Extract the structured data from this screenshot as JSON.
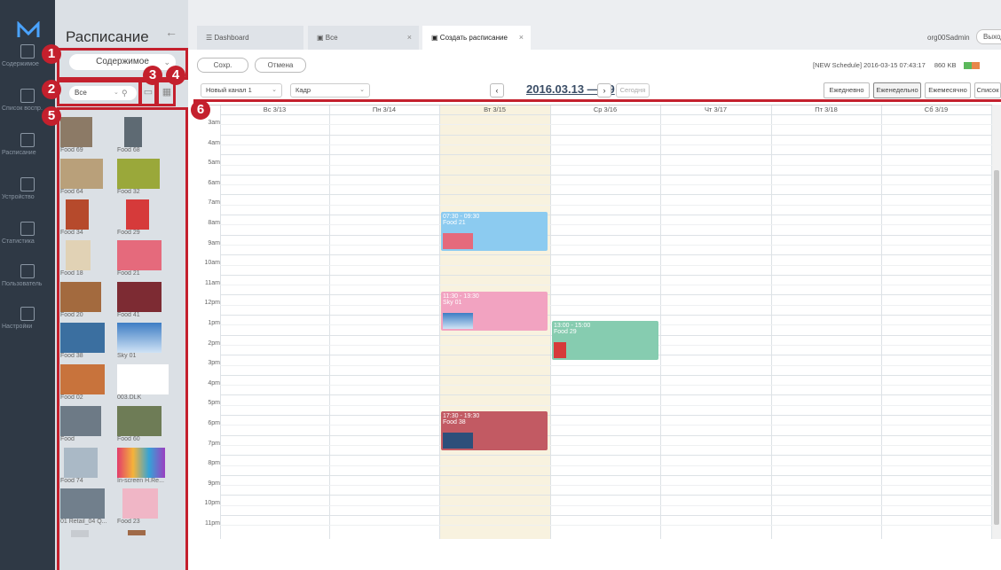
{
  "sidebar_nav": {
    "items": [
      {
        "label": "Содержимое"
      },
      {
        "label": "Список воспр."
      },
      {
        "label": "Расписание"
      },
      {
        "label": "Устройство"
      },
      {
        "label": "Статистика"
      },
      {
        "label": "Пользователь"
      },
      {
        "label": "Настройки"
      }
    ]
  },
  "panel": {
    "title": "Расписание",
    "content_dropdown": "Содержимое",
    "filter_value": "Все",
    "thumbnails": [
      {
        "caption": "Food 69"
      },
      {
        "caption": "Food 68"
      },
      {
        "caption": "Food 64"
      },
      {
        "caption": "Food 32"
      },
      {
        "caption": "Food 34"
      },
      {
        "caption": "Food 29"
      },
      {
        "caption": "Food 18"
      },
      {
        "caption": "Food 21"
      },
      {
        "caption": "Food 20"
      },
      {
        "caption": "Food 41"
      },
      {
        "caption": "Food 38"
      },
      {
        "caption": "Sky 01"
      },
      {
        "caption": "Food 02"
      },
      {
        "caption": "003.DLK"
      },
      {
        "caption": "Food"
      },
      {
        "caption": "Food 60"
      },
      {
        "caption": "Food 74"
      },
      {
        "caption": "In-screen H.Re..."
      },
      {
        "caption": "01 Retail_04 Q..."
      },
      {
        "caption": "Food 23"
      }
    ]
  },
  "badges": [
    "1",
    "2",
    "3",
    "4",
    "5",
    "6"
  ],
  "tabs": [
    {
      "label": "Dashboard"
    },
    {
      "label": "Все"
    },
    {
      "label": "Создать расписание"
    }
  ],
  "header": {
    "user": "org00Sadmin",
    "logout": "Выход"
  },
  "toolbar": {
    "save": "Сохр.",
    "cancel": "Отмена",
    "schedule_info": "[NEW Schedule] 2016-03-15 07:43:17",
    "size": "860 KB",
    "channel": "Новый канал 1",
    "frame": "Кадр",
    "date_range": "2016.03.13 — 19",
    "today": "Сегодня",
    "views": [
      "Ежедневно",
      "Еженедельно",
      "Ежемесячно",
      "Список"
    ]
  },
  "calendar": {
    "days": [
      "Вс 3/13",
      "Пн 3/14",
      "Вт 3/15",
      "Ср 3/16",
      "Чт 3/17",
      "Пт 3/18",
      "Сб 3/19"
    ],
    "hours": [
      "3am",
      "4am",
      "5am",
      "6am",
      "7am",
      "8am",
      "9am",
      "10am",
      "11am",
      "12pm",
      "1pm",
      "2pm",
      "3pm",
      "4pm",
      "5pm",
      "6pm",
      "7pm",
      "8pm",
      "9pm",
      "10pm",
      "11pm"
    ],
    "events": [
      {
        "time": "07:30 - 09:30",
        "title": "Food 21",
        "color": "#8ccbf0"
      },
      {
        "time": "11:30 - 13:30",
        "title": "Sky 01",
        "color": "#f2a3c1"
      },
      {
        "time": "13:00 - 15:00",
        "title": "Food 29",
        "color": "#86ccb0"
      },
      {
        "time": "17:30 - 19:30",
        "title": "Food 38",
        "color": "#c25a63"
      }
    ]
  }
}
